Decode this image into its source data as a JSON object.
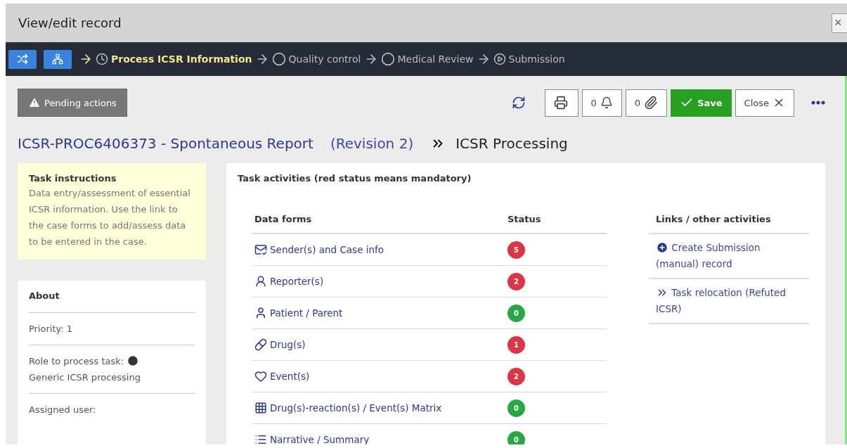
{
  "window": {
    "title": "View/edit record",
    "close": "×"
  },
  "workflow": [
    {
      "kind": "shuffle"
    },
    {
      "kind": "tree"
    }
  ],
  "steps": [
    {
      "label": "Process ICSR Information",
      "kind": "clock",
      "current": true
    },
    {
      "label": "Quality control",
      "kind": "circle",
      "current": false
    },
    {
      "label": "Medical Review",
      "kind": "circle",
      "current": false
    },
    {
      "label": "Submission",
      "kind": "play",
      "current": false
    }
  ],
  "toolbar": {
    "pending": "Pending actions",
    "alerts": "0",
    "attachments": "0",
    "save": "Save",
    "close": "Close"
  },
  "record": {
    "title": "ICSR-PROC6406373 - Spontaneous Report",
    "revision": "(Revision 2)",
    "process": "ICSR Processing"
  },
  "instructions": {
    "title": "Task instructions",
    "text": "Data entry/assessment of essential ICSR information. Use the link to the case forms to add/assess data to be entered in the case."
  },
  "about": {
    "title": "About",
    "items": [
      {
        "kind": "text",
        "text": "Priority: 1"
      },
      {
        "kind": "role",
        "label": "Role to process task:",
        "value": "Generic ICSR processing"
      },
      {
        "kind": "text",
        "text": "Assigned user:"
      }
    ]
  },
  "activities": {
    "title": "Task activities (red status means mandatory)",
    "columns": [
      "Data forms",
      "Status"
    ],
    "rows": [
      {
        "kind": "sender",
        "label": "Sender(s) and Case info",
        "status": "5",
        "color": "#dc3545"
      },
      {
        "kind": "reporter",
        "label": "Reporter(s)",
        "status": "2",
        "color": "#dc3545"
      },
      {
        "kind": "patient",
        "label": "Patient / Parent",
        "status": "0",
        "color": "#28a745"
      },
      {
        "kind": "drug",
        "label": "Drug(s)",
        "status": "1",
        "color": "#dc3545"
      },
      {
        "kind": "event",
        "label": "Event(s)",
        "status": "2",
        "color": "#dc3545"
      },
      {
        "kind": "matrix",
        "label": "Drug(s)-reaction(s) / Event(s) Matrix",
        "status": "0",
        "color": "#28a745"
      },
      {
        "kind": "list",
        "label": "Narrative / Summary",
        "status": "0",
        "color": "#28a745"
      }
    ]
  },
  "links": {
    "title": "Links / other activities",
    "items": [
      {
        "kind": "plus",
        "label": "Create Submission (manual) record"
      },
      {
        "kind": "chevrons",
        "label": "Task relocation (Refuted ICSR)"
      }
    ]
  }
}
